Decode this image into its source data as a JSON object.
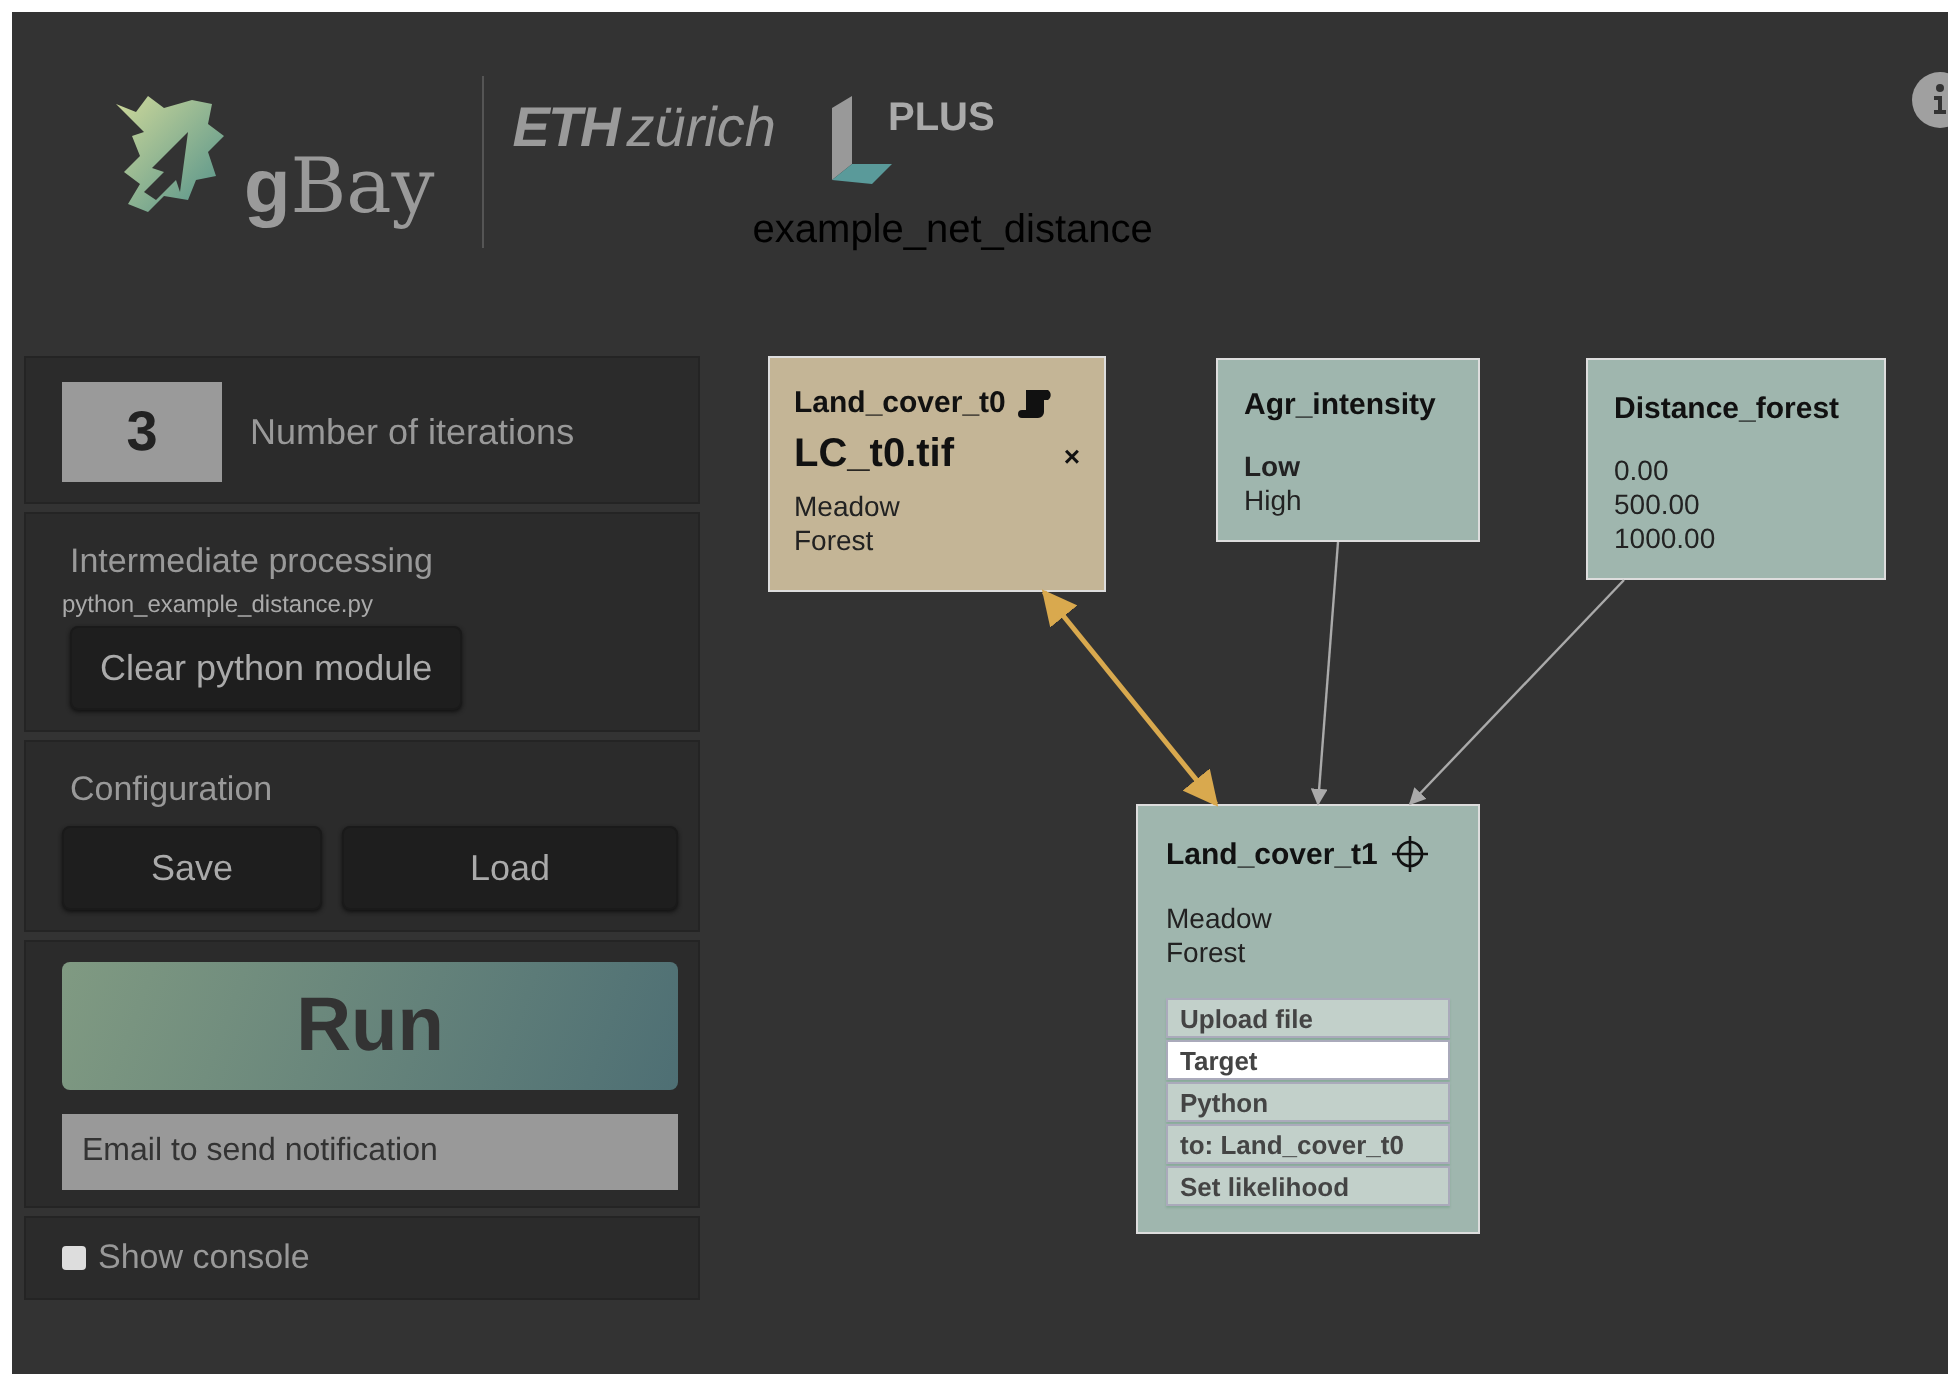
{
  "header": {
    "app_logo": {
      "strong": "g",
      "rest": "Bay"
    },
    "partner_logo": {
      "strong": "ETH",
      "rest": "zürich"
    },
    "plus_logo": "PLUS",
    "project_title": "example_net_distance"
  },
  "sidebar": {
    "iterations": {
      "value": "3",
      "label": "Number of iterations"
    },
    "processing": {
      "title": "Intermediate processing",
      "file": "python_example_distance.py",
      "button": "Clear python module"
    },
    "configuration": {
      "title": "Configuration",
      "buttons": [
        "Save",
        "Load"
      ]
    },
    "run": {
      "button": "Run",
      "email": {
        "placeholder": "Email to send notification"
      }
    },
    "console": {
      "label": "Show console",
      "checked": false
    }
  },
  "network": {
    "nodes": [
      {
        "kind": "evidence",
        "title": "Land_cover_t0",
        "file": "LC_t0.tif",
        "close": "×",
        "color": "#c4b596",
        "states": [
          {
            "label": "Meadow",
            "selected": false
          },
          {
            "label": "Forest",
            "selected": false
          }
        ]
      },
      {
        "kind": "plain",
        "title": "Agr_intensity",
        "color": "#9fb6ae",
        "states": [
          {
            "label": "Low",
            "selected": true
          },
          {
            "label": "High",
            "selected": false
          }
        ]
      },
      {
        "kind": "plain",
        "title": "Distance_forest",
        "color": "#9fb6ae",
        "states": [
          {
            "label": "0.00",
            "selected": false
          },
          {
            "label": "500.00",
            "selected": false
          },
          {
            "label": "1000.00",
            "selected": false
          }
        ]
      },
      {
        "kind": "target",
        "title": "Land_cover_t1",
        "color": "#9fb6ae",
        "states": [
          {
            "label": "Meadow",
            "selected": false
          },
          {
            "label": "Forest",
            "selected": false
          }
        ],
        "menu": [
          {
            "label": "Upload file",
            "selected": false
          },
          {
            "label": "Target",
            "selected": true
          },
          {
            "label": "Python",
            "selected": false
          },
          {
            "label": "to: Land_cover_t0",
            "selected": false
          },
          {
            "label": "Set likelihood",
            "selected": false
          }
        ]
      }
    ],
    "edges": [
      {
        "color": "#d9a94e",
        "two_way": true
      },
      {
        "color": "#aaaaaa",
        "two_way": false
      },
      {
        "color": "#aaaaaa",
        "two_way": false
      }
    ]
  }
}
